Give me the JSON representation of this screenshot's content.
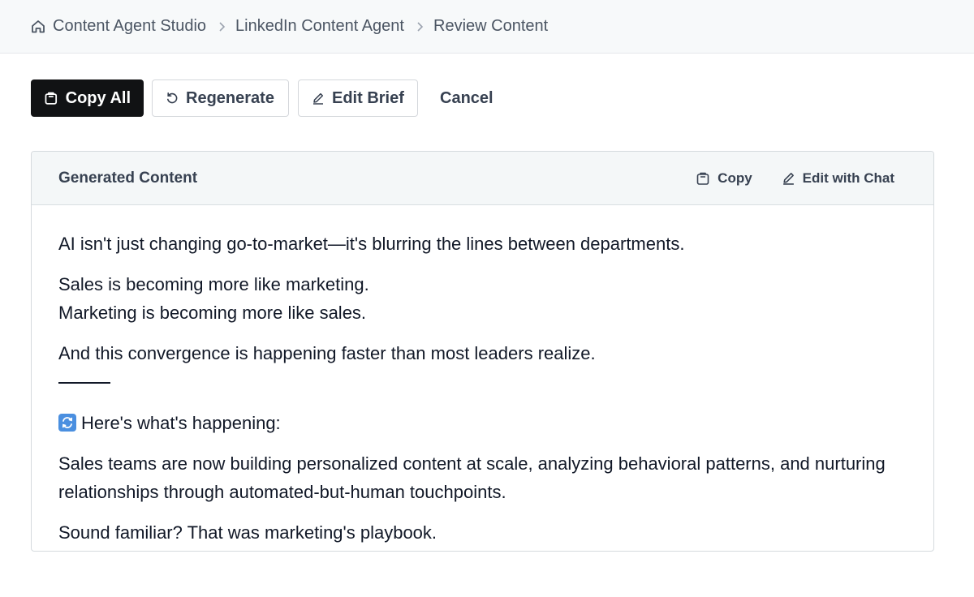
{
  "breadcrumb": {
    "items": [
      "Content Agent Studio",
      "LinkedIn Content Agent",
      "Review Content"
    ]
  },
  "toolbar": {
    "copy_all_label": "Copy All",
    "regenerate_label": "Regenerate",
    "edit_brief_label": "Edit Brief",
    "cancel_label": "Cancel"
  },
  "panel": {
    "title": "Generated Content",
    "copy_label": "Copy",
    "edit_chat_label": "Edit with Chat",
    "paragraphs": {
      "p1": "AI isn't just changing go-to-market—it's blurring the lines between departments.",
      "p2a": "Sales is becoming more like marketing.",
      "p2b": "Marketing is becoming more like sales.",
      "p3": "And this convergence is happening faster than most leaders realize.",
      "p4": "Here's what's happening:",
      "p5": "Sales teams are now building personalized content at scale, analyzing behavioral patterns, and nurturing relationships through automated-but-human touchpoints.",
      "p6": "Sound familiar? That was marketing's playbook."
    }
  },
  "icons": {
    "home": "home-icon",
    "chevron": "chevron-right-icon",
    "clipboard": "clipboard-icon",
    "refresh": "refresh-icon",
    "pencil": "pencil-icon",
    "emoji": "arrows-cycle-emoji-icon"
  },
  "colors": {
    "primary_button": "#111214",
    "topbar_bg": "#f7f9fa",
    "panel_header_bg": "#f4f7f8",
    "emoji_blue": "#4a8fe0"
  }
}
